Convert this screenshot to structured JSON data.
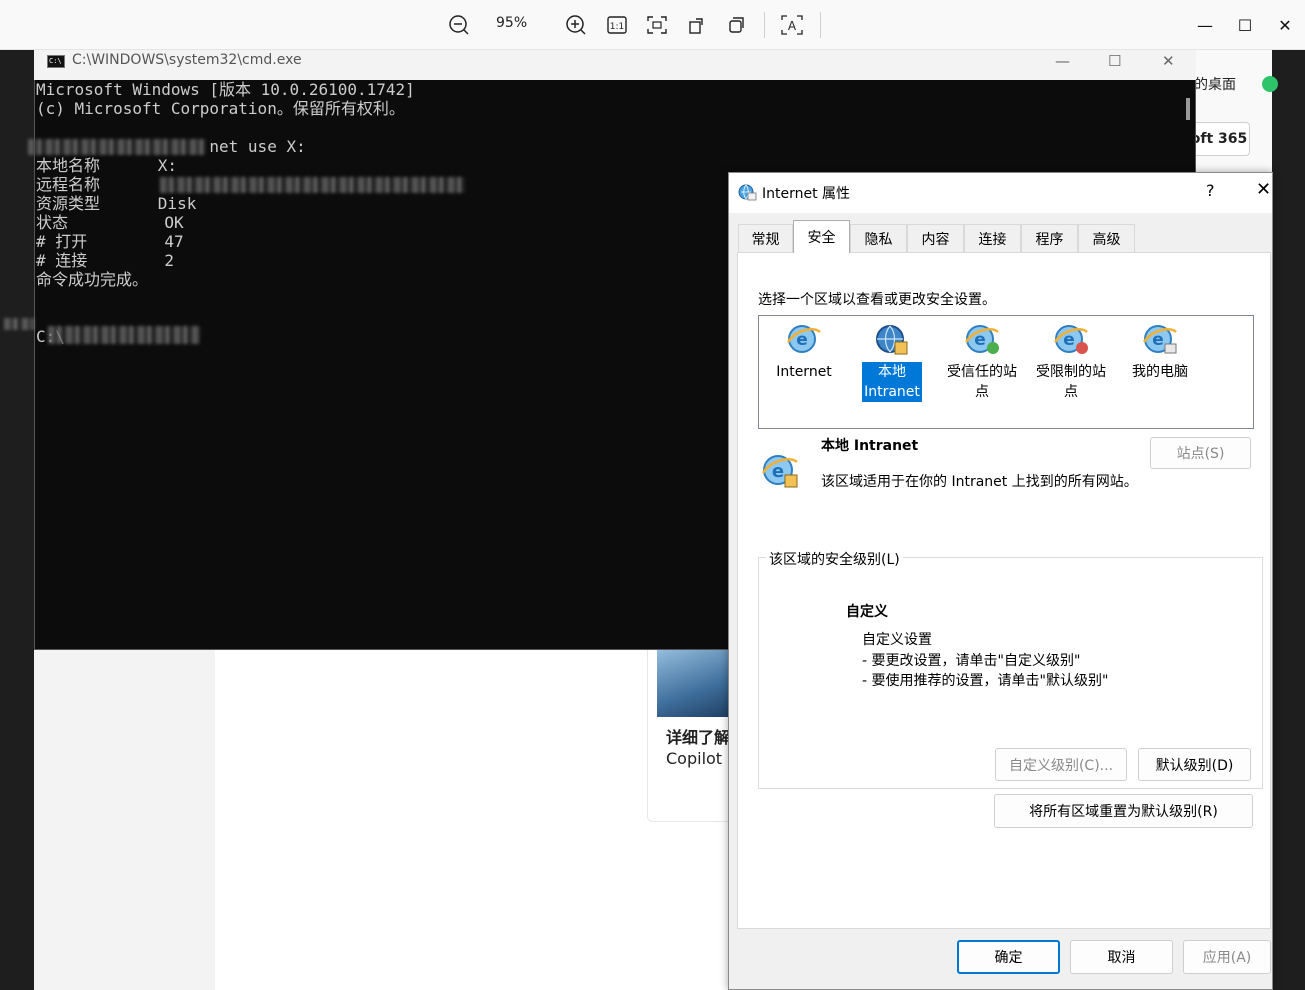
{
  "viewer": {
    "zoom": "95%",
    "tools": [
      "zoom-out-icon",
      "zoom-in-icon",
      "actual-size-icon",
      "fit-icon",
      "rotate-icon",
      "copy-icon",
      "ocr-icon"
    ]
  },
  "background": {
    "desktop_label": "的桌面",
    "m365_label": "oft 365",
    "card_title": "详细了解",
    "card_subtitle": "Copilot"
  },
  "cmd": {
    "title": "C:\\WINDOWS\\system32\\cmd.exe",
    "lines": [
      "Microsoft Windows [版本 10.0.26100.1742]",
      "(c) Microsoft Corporation。保留所有权利。",
      "",
      "                  net use X:",
      "本地名称      X:",
      "远程名称",
      "资源类型      Disk",
      "状态          OK",
      "# 打开        47",
      "# 连接        2",
      "命令成功完成。",
      "",
      "",
      "C:\\"
    ]
  },
  "dialog": {
    "title": "Internet 属性",
    "help": "?",
    "close": "✕",
    "tabs": [
      "常规",
      "安全",
      "隐私",
      "内容",
      "连接",
      "程序",
      "高级"
    ],
    "active_tab": "安全",
    "zone_prompt": "选择一个区域以查看或更改安全设置。",
    "zones": [
      {
        "line1": "Internet",
        "line2": ""
      },
      {
        "line1": "本地",
        "line2": "Intranet"
      },
      {
        "line1": "受信任的站",
        "line2": "点"
      },
      {
        "line1": "受限制的站",
        "line2": "点"
      },
      {
        "line1": "我的电脑",
        "line2": ""
      }
    ],
    "selected_zone": "本地 Intranet",
    "zone_name": "本地 Intranet",
    "zone_description": "该区域适用于在你的 Intranet 上找到的所有网站。",
    "sites_button": "站点(S)",
    "security_group_label": "该区域的安全级别(L)",
    "level_name": "自定义",
    "level_lines": [
      "自定义设置",
      "- 要更改设置，请单击\"自定义级别\"",
      "- 要使用推荐的设置，请单击\"默认级别\""
    ],
    "custom_level_button": "自定义级别(C)...",
    "default_level_button": "默认级别(D)",
    "reset_all_button": "将所有区域重置为默认级别(R)",
    "ok_button": "确定",
    "cancel_button": "取消",
    "apply_button": "应用(A)"
  }
}
